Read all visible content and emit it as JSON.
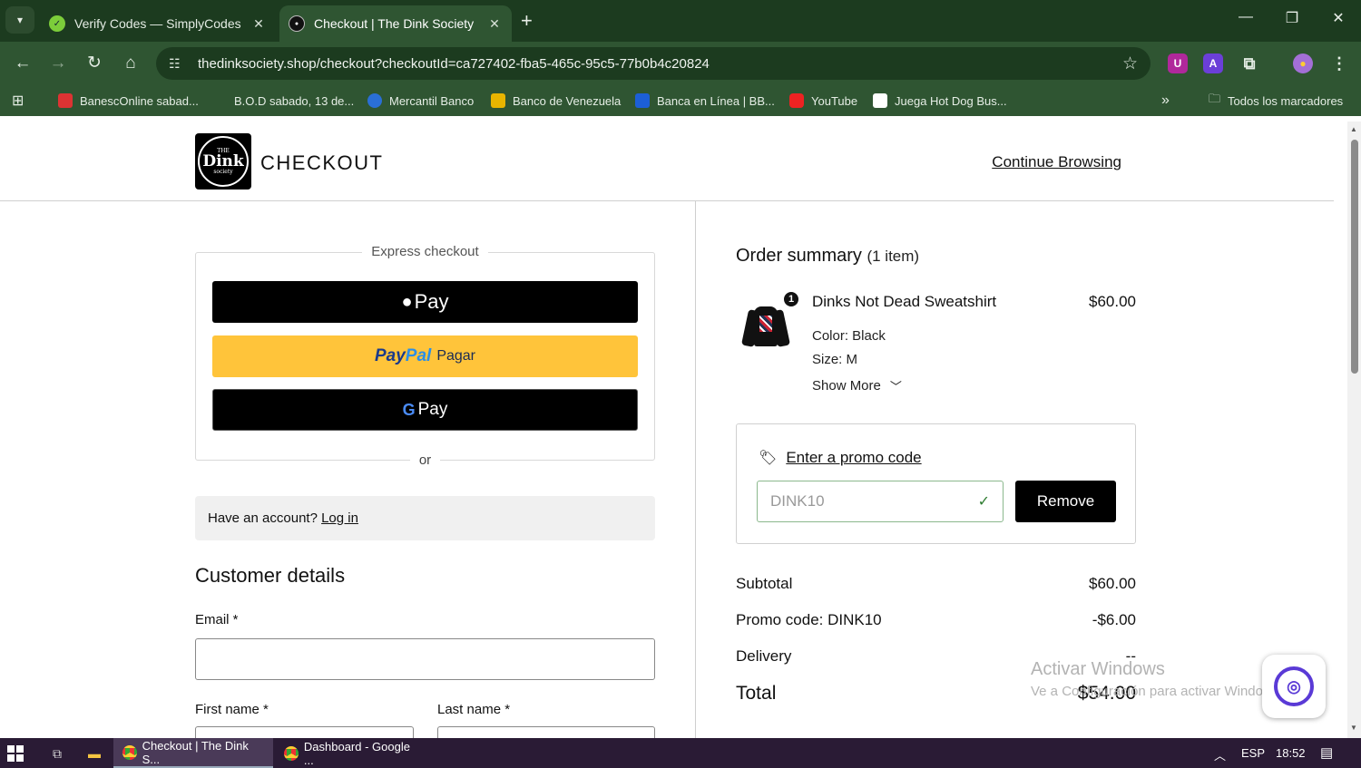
{
  "browser": {
    "tabs": [
      {
        "title": "Verify Codes — SimplyCodes",
        "active": false
      },
      {
        "title": "Checkout | The Dink Society",
        "active": true
      }
    ],
    "url": "thedinksociety.shop/checkout?checkoutId=ca727402-fba5-465c-95c5-77b0b4c20824",
    "bookmarks": [
      {
        "label": "BanescOnline sabad...",
        "color": "#d33"
      },
      {
        "label": "B.O.D sabado, 13 de...",
        "color": ""
      },
      {
        "label": "Mercantil Banco",
        "color": "#2a6fd6"
      },
      {
        "label": "Banco de Venezuela",
        "color": "#e8b500"
      },
      {
        "label": "Banca en Línea | BB...",
        "color": "#1c5fd6"
      },
      {
        "label": "YouTube",
        "color": "#e22"
      },
      {
        "label": "Juega Hot Dog Bus...",
        "color": "#fff"
      }
    ],
    "all_bookmarks": "Todos los marcadores"
  },
  "header": {
    "logo_small": "THE",
    "logo_big": "Dink",
    "logo_sub": "society",
    "title": "CHECKOUT",
    "continue": "Continue Browsing"
  },
  "express": {
    "label": "Express checkout",
    "apple_pay": "Pay",
    "paypal_pay": "Pay",
    "paypal_pal": "Pal",
    "paypal_action": "Pagar",
    "gpay_g": "G",
    "gpay": "Pay",
    "or": "or"
  },
  "account": {
    "prompt": "Have an account?",
    "login": "Log in"
  },
  "customer": {
    "title": "Customer details",
    "email_label": "Email *",
    "first_name_label": "First name *",
    "last_name_label": "Last name *"
  },
  "summary": {
    "title": "Order summary",
    "count": "(1 item)",
    "item": {
      "qty": "1",
      "name": "Dinks Not Dead Sweatshirt",
      "price": "$60.00",
      "color": "Color: Black",
      "size": "Size: M",
      "show_more": "Show More"
    },
    "promo": {
      "link": "Enter a promo code",
      "value": "DINK10",
      "remove": "Remove"
    },
    "rows": {
      "subtotal_label": "Subtotal",
      "subtotal": "$60.00",
      "promo_label": "Promo code: DINK10",
      "promo": "-$6.00",
      "delivery_label": "Delivery",
      "delivery": "--",
      "total_label": "Total",
      "total": "$54.00"
    }
  },
  "watermark": {
    "line1": "Activar Windows",
    "line2": "Ve a Configuración para activar Windows."
  },
  "taskbar": {
    "items": [
      "Checkout | The Dink S...",
      "Dashboard - Google ..."
    ],
    "lang": "ESP",
    "time": "18:52"
  }
}
